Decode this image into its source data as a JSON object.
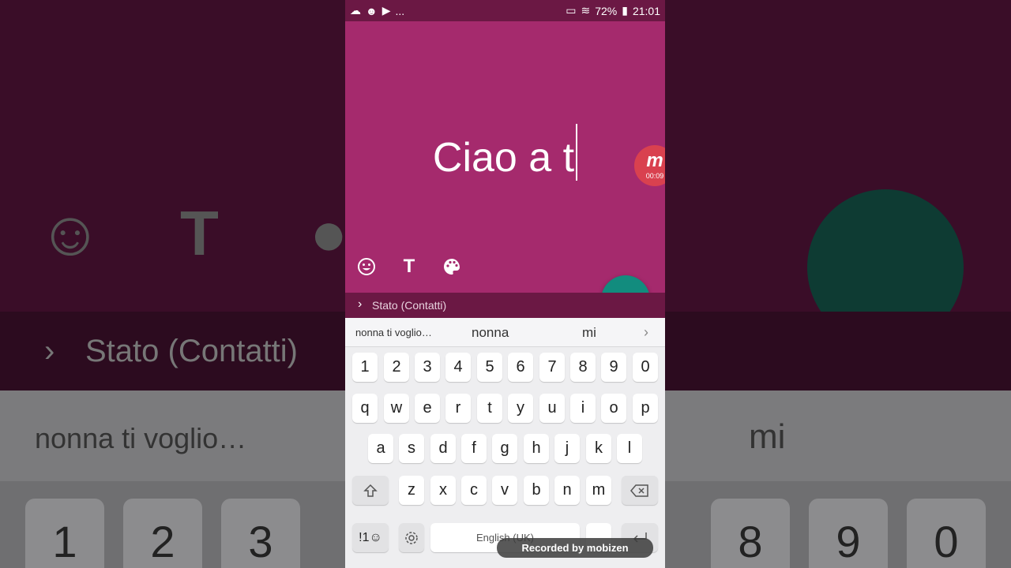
{
  "status_bar": {
    "battery_percent": "72%",
    "time": "21:01",
    "overflow": "...",
    "icons": [
      "cloud-icon",
      "face-icon",
      "youtube-icon",
      "cast-icon",
      "wifi-icon",
      "signal-icon",
      "battery-icon"
    ]
  },
  "composer": {
    "typed_text": "Ciao a t",
    "recording_badge_letter": "m",
    "recording_badge_time": "00:09",
    "tools": [
      "emoji-icon",
      "text-style-icon",
      "palette-icon"
    ],
    "tool_T": "T",
    "accent_color": "#a52a6d",
    "send_color": "#128c7e"
  },
  "destination": {
    "label": "Stato (Contatti)"
  },
  "keyboard": {
    "suggestions": [
      "nonna ti voglio…",
      "nonna",
      "mi"
    ],
    "row_numbers": [
      "1",
      "2",
      "3",
      "4",
      "5",
      "6",
      "7",
      "8",
      "9",
      "0"
    ],
    "row_top": [
      "q",
      "w",
      "e",
      "r",
      "t",
      "y",
      "u",
      "i",
      "o",
      "p"
    ],
    "row_middle": [
      "a",
      "s",
      "d",
      "f",
      "g",
      "h",
      "j",
      "k",
      "l"
    ],
    "row_bottom": [
      "z",
      "x",
      "c",
      "v",
      "b",
      "n",
      "m"
    ],
    "symbols_key": "!1☺",
    "space_label": "English (UK)"
  },
  "watermark": {
    "text": "Recorded by mobizen"
  }
}
